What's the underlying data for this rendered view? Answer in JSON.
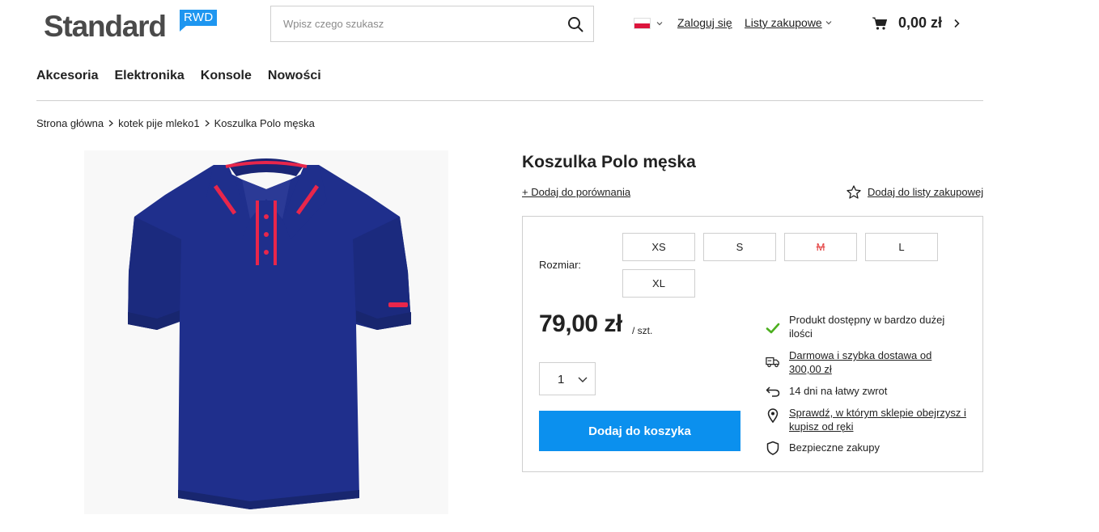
{
  "header": {
    "logo_text": "Standard",
    "logo_badge": "RWD",
    "search_placeholder": "Wpisz czego szukasz",
    "login_label": "Zaloguj się",
    "lists_label": "Listy zakupowe",
    "cart_total": "0,00 zł"
  },
  "nav": {
    "items": [
      {
        "label": "Akcesoria"
      },
      {
        "label": "Elektronika"
      },
      {
        "label": "Konsole"
      },
      {
        "label": "Nowości"
      }
    ]
  },
  "breadcrumb": {
    "items": [
      {
        "label": "Strona główna"
      },
      {
        "label": "kotek pije mleko1"
      },
      {
        "label": "Koszulka Polo męska"
      }
    ]
  },
  "product": {
    "title": "Koszulka Polo męska",
    "compare_label": "+ Dodaj do porównania",
    "wishlist_label": "Dodaj do listy zakupowej",
    "size_label": "Rozmiar:",
    "sizes": [
      {
        "label": "XS",
        "available": true
      },
      {
        "label": "S",
        "available": true
      },
      {
        "label": "M",
        "available": false
      },
      {
        "label": "L",
        "available": true
      },
      {
        "label": "XL",
        "available": true
      }
    ],
    "price": "79,00 zł",
    "price_unit": "/ szt.",
    "quantity": "1",
    "add_to_cart_label": "Dodaj do koszyka",
    "features": [
      {
        "icon": "check-icon",
        "text_line1": "Produkt dostępny w bardzo dużej",
        "text_line2": "ilości",
        "link": false
      },
      {
        "icon": "truck-icon",
        "text_line1": "Darmowa i szybka dostawa od",
        "text_line2": "300,00 zł",
        "link": true
      },
      {
        "icon": "return-icon",
        "text_line1": "14 dni na łatwy zwrot",
        "text_line2": "",
        "link": false
      },
      {
        "icon": "location-pin-icon",
        "text_line1": "Sprawdź, w którym sklepie obejrzysz i",
        "text_line2": "kupisz od ręki",
        "link": true
      },
      {
        "icon": "shield-icon",
        "text_line1": "Bezpieczne zakupy",
        "text_line2": "",
        "link": false
      }
    ]
  },
  "colors": {
    "accent_blue": "#0b90ee",
    "logo_badge": "#1e96f0",
    "unavailable_red": "#e33b3b",
    "check_green": "#4caf1f",
    "shirt_navy": "#1f2f8c",
    "collar_red": "#e8264b"
  }
}
